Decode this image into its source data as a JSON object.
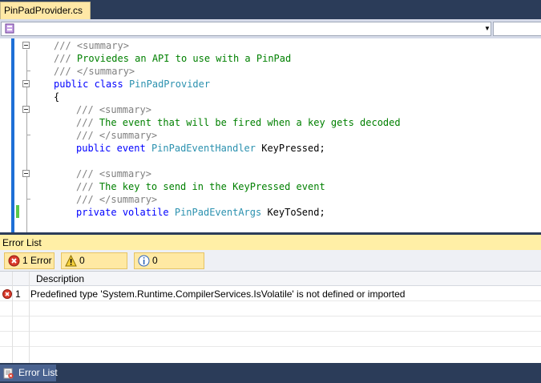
{
  "document_tab": {
    "title": "PinPadProvider.cs"
  },
  "nav_bar": {
    "type_value": "",
    "member_value": ""
  },
  "code_lines": [
    [
      {
        "t": "/// ",
        "c": "g"
      },
      {
        "t": "<summary>",
        "c": "g"
      }
    ],
    [
      {
        "t": "/// ",
        "c": "g"
      },
      {
        "t": "Proviedes an API to use with a PinPad",
        "c": "c"
      }
    ],
    [
      {
        "t": "/// ",
        "c": "g"
      },
      {
        "t": "</summary>",
        "c": "g"
      }
    ],
    [
      {
        "t": "public",
        "c": "k"
      },
      {
        "t": " "
      },
      {
        "t": "class",
        "c": "k"
      },
      {
        "t": " "
      },
      {
        "t": "PinPadProvider",
        "c": "t"
      }
    ],
    [
      {
        "t": "{"
      }
    ],
    [
      {
        "t": "/// ",
        "c": "g"
      },
      {
        "t": "<summary>",
        "c": "g"
      }
    ],
    [
      {
        "t": "/// ",
        "c": "g"
      },
      {
        "t": "The event that will be fired when a key gets decoded",
        "c": "c"
      }
    ],
    [
      {
        "t": "/// ",
        "c": "g"
      },
      {
        "t": "</summary>",
        "c": "g"
      }
    ],
    [
      {
        "t": "public",
        "c": "k"
      },
      {
        "t": " "
      },
      {
        "t": "event",
        "c": "k"
      },
      {
        "t": " "
      },
      {
        "t": "PinPadEventHandler",
        "c": "t"
      },
      {
        "t": " KeyPressed;"
      }
    ],
    [],
    [
      {
        "t": "/// ",
        "c": "g"
      },
      {
        "t": "<summary>",
        "c": "g"
      }
    ],
    [
      {
        "t": "/// ",
        "c": "g"
      },
      {
        "t": "The key to send in the KeyPressed event",
        "c": "c"
      }
    ],
    [
      {
        "t": "/// ",
        "c": "g"
      },
      {
        "t": "</summary>",
        "c": "g"
      }
    ],
    [
      {
        "t": "private",
        "c": "k"
      },
      {
        "t": " "
      },
      {
        "t": "volatile",
        "c": "k"
      },
      {
        "t": " "
      },
      {
        "t": "PinPadEventArgs",
        "c": "t"
      },
      {
        "t": " KeyToSend;"
      }
    ]
  ],
  "error_list": {
    "title": "Error List",
    "filters": {
      "errors": "1 Error",
      "warnings": "0 Warnings",
      "messages": "0 Messages"
    },
    "columns": {
      "number": "",
      "description": "Description"
    },
    "rows": [
      {
        "number": "1",
        "description": "Predefined type 'System.Runtime.CompilerServices.IsVolatile' is not defined or imported"
      }
    ]
  },
  "bottom_tab": {
    "label": "Error List"
  },
  "colors": {
    "tab_active": "#ffe8a6",
    "keyword": "#0000ff",
    "type": "#2b91af",
    "comment": "#008000",
    "comment_tag": "#808080",
    "frame": "#2b3c59"
  },
  "icons": {
    "class_icon": "class-icon",
    "error_icon": "error-icon",
    "warning_icon": "warning-icon",
    "info_icon": "info-icon"
  }
}
